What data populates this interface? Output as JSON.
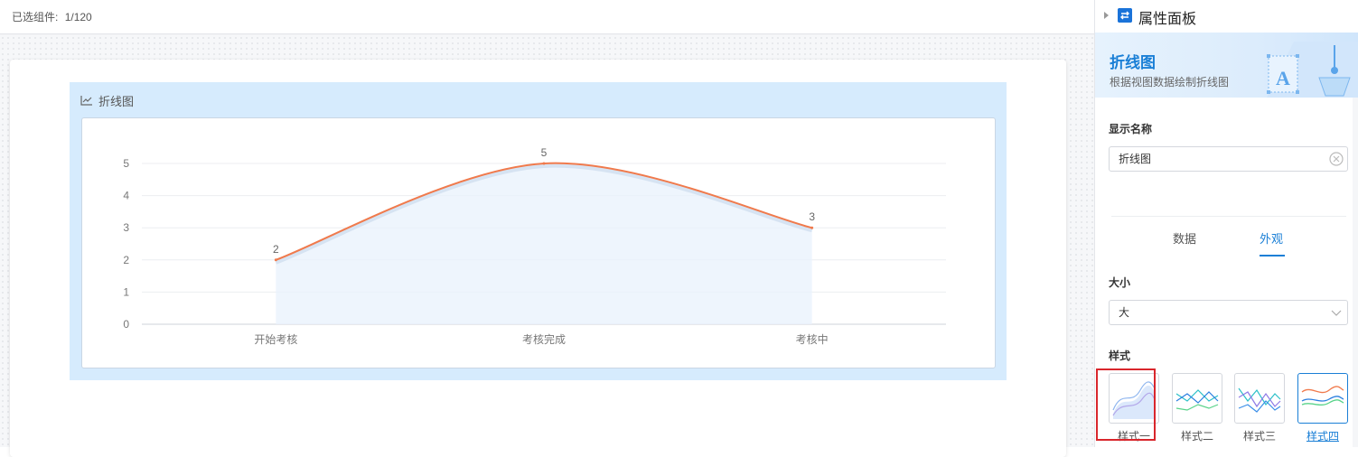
{
  "toolbar": {
    "selected_label": "已选组件:",
    "selected_count": "1/120"
  },
  "widget": {
    "title": "折线图",
    "icon": "line-chart-icon"
  },
  "chart_data": {
    "type": "area",
    "categories": [
      "开始考核",
      "考核完成",
      "考核中"
    ],
    "values": [
      2,
      5,
      3
    ],
    "data_labels": [
      "2",
      "5",
      "3"
    ],
    "title": "",
    "xlabel": "",
    "ylabel": "",
    "ylim": [
      0,
      5
    ],
    "y_ticks": [
      "0",
      "1",
      "2",
      "3",
      "4",
      "5"
    ],
    "smooth": true,
    "grid": true,
    "line_color": "#f07a4c",
    "fill_color": "#eaf3fc"
  },
  "panel": {
    "title": "属性面板",
    "component_name": "折线图",
    "component_desc": "根据视图数据绘制折线图",
    "display_name_label": "显示名称",
    "display_name_value": "折线图",
    "tabs": [
      {
        "label": "数据",
        "active": false
      },
      {
        "label": "外观",
        "active": true
      }
    ],
    "size_label": "大小",
    "size_value": "大",
    "style_label": "样式",
    "styles": [
      {
        "label": "样式一",
        "selected": false
      },
      {
        "label": "样式二",
        "selected": false
      },
      {
        "label": "样式三",
        "selected": false
      },
      {
        "label": "样式四",
        "selected": true
      }
    ],
    "accent_color": "#1a7fd6",
    "highlight_color": "#d9262c"
  }
}
